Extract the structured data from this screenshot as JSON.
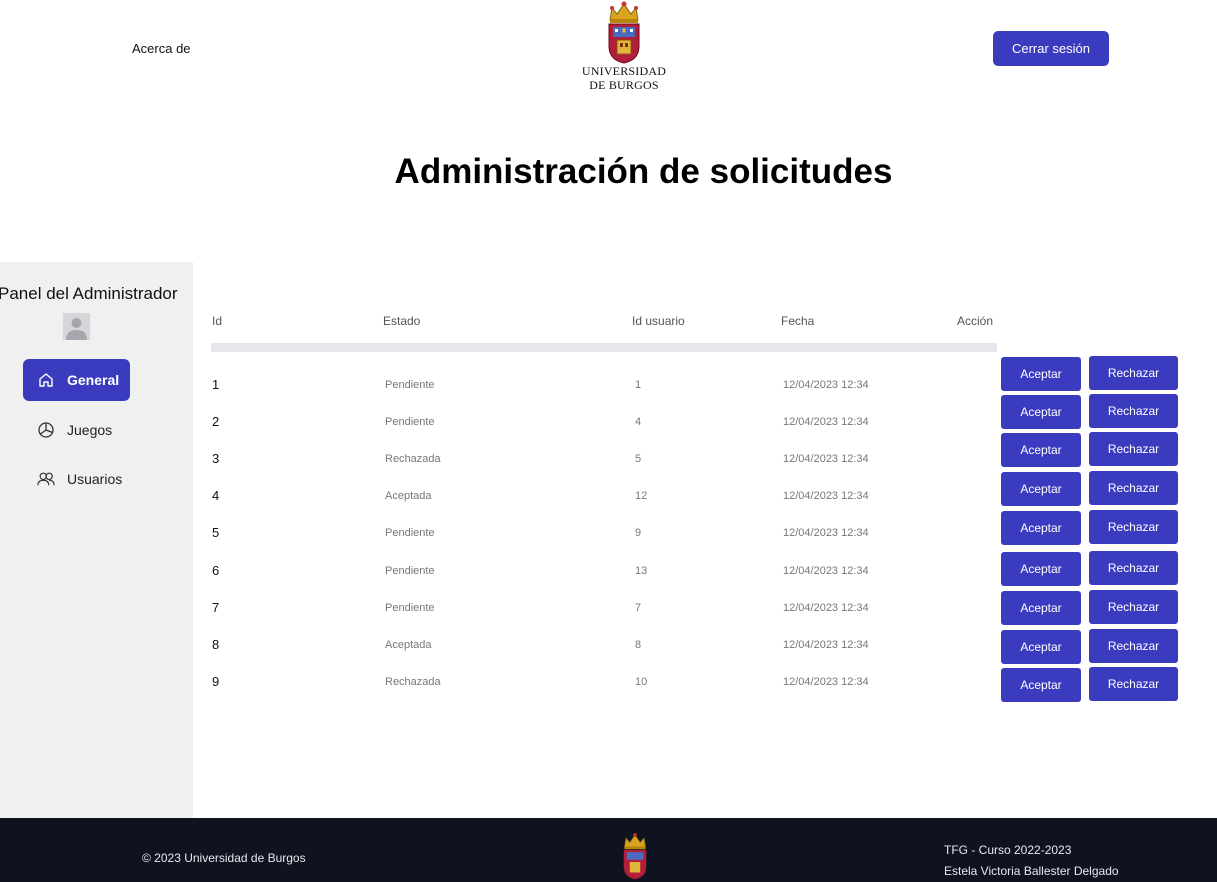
{
  "header": {
    "about_label": "Acerca de",
    "logo_line1": "UNIVERSIDAD",
    "logo_line2": "DE BURGOS",
    "logout_label": "Cerrar sesión"
  },
  "page_title": "Administración de solicitudes",
  "sidebar": {
    "title": "Panel del Administrador",
    "items": [
      {
        "label": "General",
        "icon": "home-icon",
        "active": true
      },
      {
        "label": "Juegos",
        "icon": "pie-chart-icon",
        "active": false
      },
      {
        "label": "Usuarios",
        "icon": "users-icon",
        "active": false
      }
    ]
  },
  "table": {
    "columns": [
      "Id",
      "Estado",
      "Id usuario",
      "Fecha",
      "Acción"
    ],
    "accept_label": "Aceptar",
    "reject_label": "Rechazar",
    "rows": [
      {
        "id": "1",
        "estado": "Pendiente",
        "usuario": "1",
        "fecha": "12/04/2023 12:34"
      },
      {
        "id": "2",
        "estado": "Pendiente",
        "usuario": "4",
        "fecha": "12/04/2023 12:34"
      },
      {
        "id": "3",
        "estado": "Rechazada",
        "usuario": "5",
        "fecha": "12/04/2023 12:34"
      },
      {
        "id": "4",
        "estado": "Aceptada",
        "usuario": "12",
        "fecha": "12/04/2023 12:34"
      },
      {
        "id": "5",
        "estado": "Pendiente",
        "usuario": "9",
        "fecha": "12/04/2023 12:34"
      },
      {
        "id": "6",
        "estado": "Pendiente",
        "usuario": "13",
        "fecha": "12/04/2023 12:34"
      },
      {
        "id": "7",
        "estado": "Pendiente",
        "usuario": "7",
        "fecha": "12/04/2023 12:34"
      },
      {
        "id": "8",
        "estado": "Aceptada",
        "usuario": "8",
        "fecha": "12/04/2023 12:34"
      },
      {
        "id": "9",
        "estado": "Rechazada",
        "usuario": "10",
        "fecha": "12/04/2023 12:34"
      }
    ]
  },
  "footer": {
    "copyright": "© 2023 Universidad de Burgos",
    "course": "TFG - Curso 2022-2023",
    "author": "Estela Victoria Ballester Delgado"
  },
  "colors": {
    "primary": "#3b3bbf",
    "sidebar_bg": "#f0f0f1",
    "footer_bg": "#0f1320"
  }
}
